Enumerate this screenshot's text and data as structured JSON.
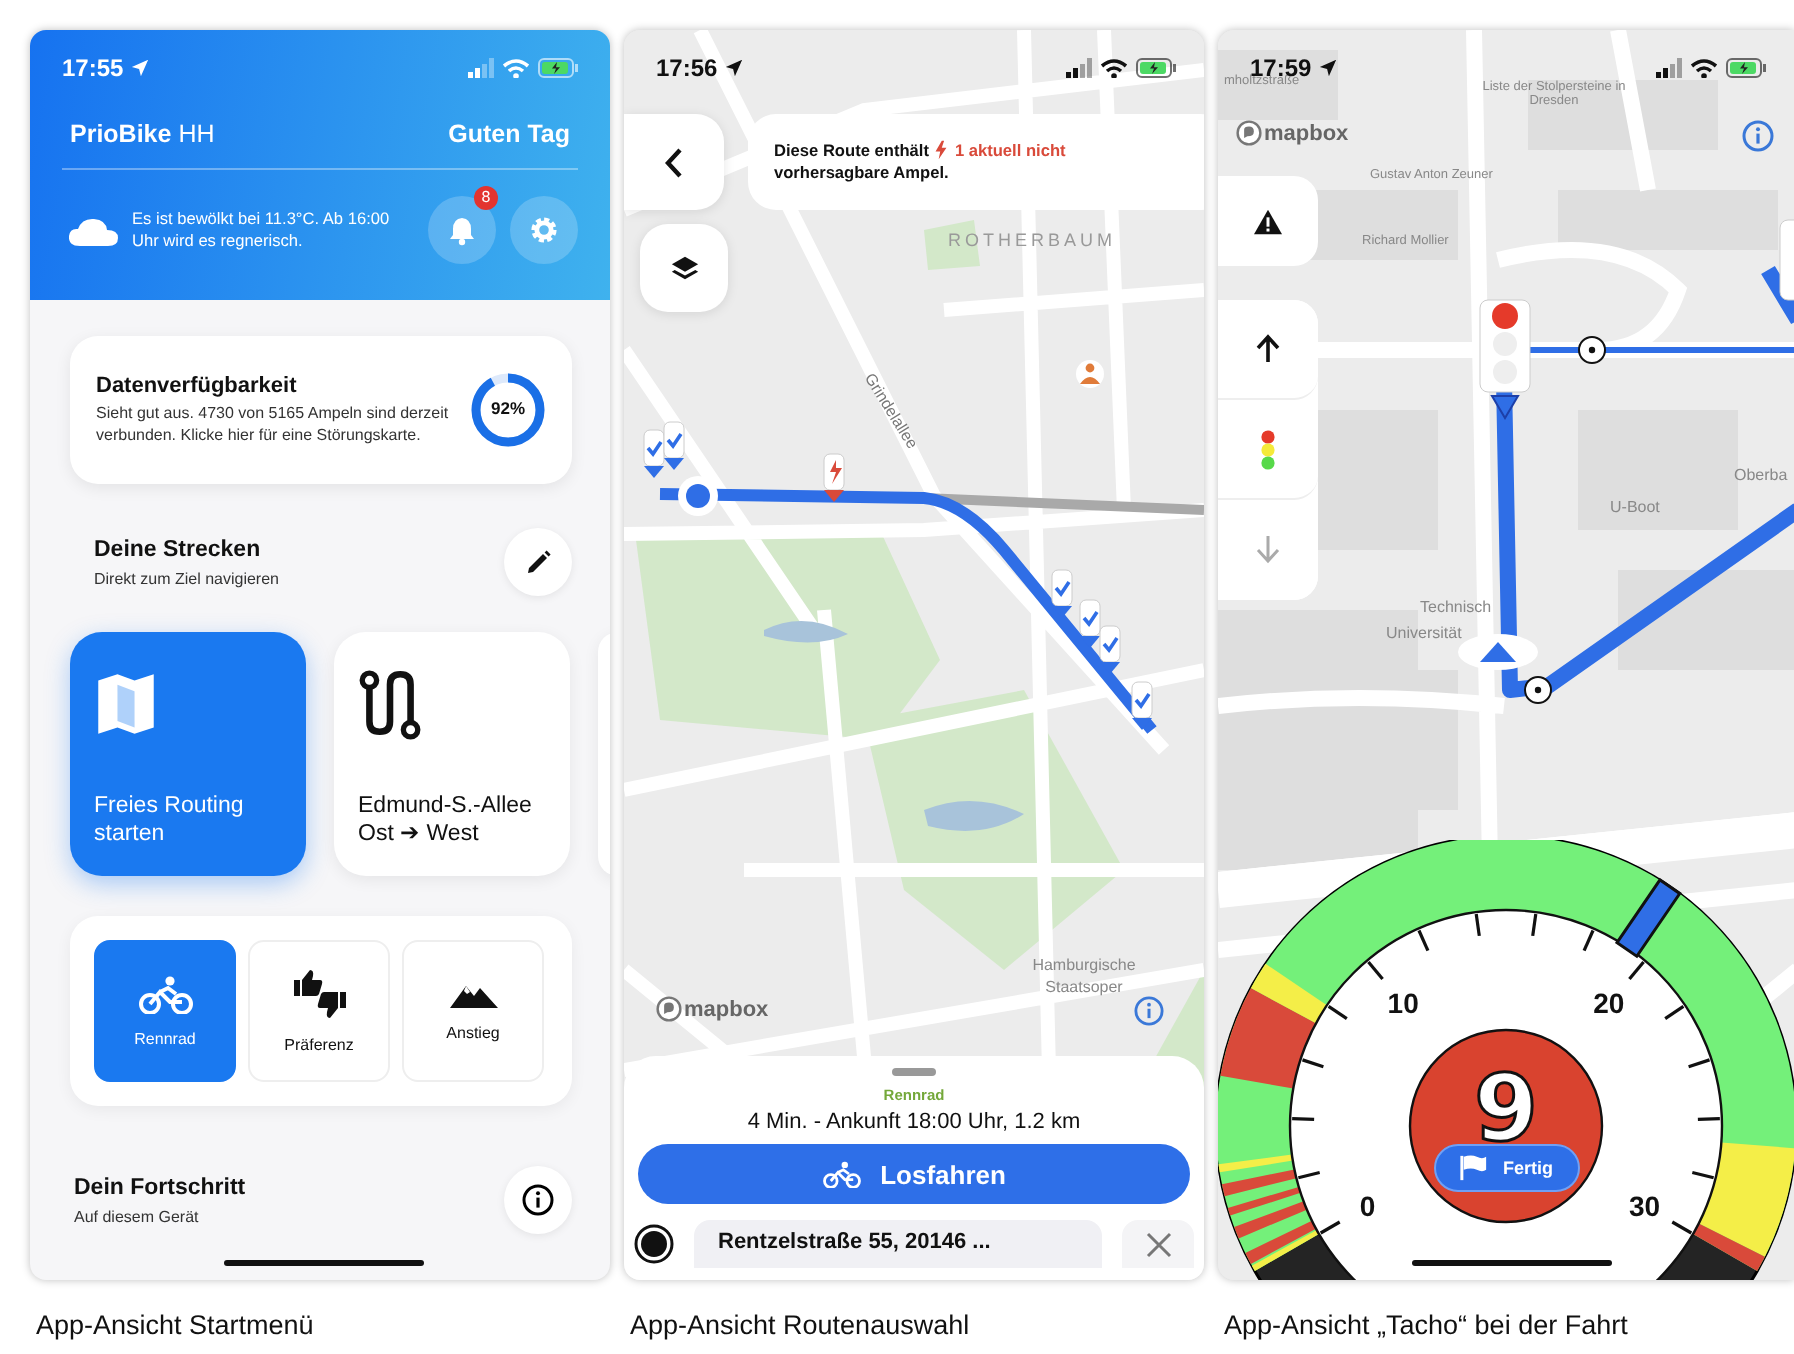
{
  "home_screen": {
    "status_bar": {
      "time": "17:55"
    },
    "app_title": "**PrioBike** HH",
    "greeting": "Guten Tag",
    "weather": "Es ist bewölkt bei 11.3°C. Ab 16:00 Uhr wird es regnerisch.",
    "notifications_badge": "8",
    "data_card": {
      "title": "Datenverfügbarkeit",
      "text": "Sieht gut aus. 4730 von 5165 Ampeln sind derzeit verbunden. Klicke hier für eine Störungskarte.",
      "percent": "92%",
      "level": 0.92
    },
    "routes_section": {
      "title": "Deine Strecken",
      "subtitle": "Direkt zum Ziel navigieren"
    },
    "route_cards": [
      {
        "kind": "free",
        "label": "Freies Routing starten"
      },
      {
        "kind": "saved",
        "label": "Edmund-S.-Allee Ost ➔ West"
      }
    ],
    "profile_buttons": [
      {
        "kind": "bike",
        "label": "Rennrad",
        "selected": true
      },
      {
        "kind": "thumbs",
        "label": "Präferenz",
        "selected": false
      },
      {
        "kind": "mountain",
        "label": "Anstieg",
        "selected": false
      }
    ],
    "progress_section": {
      "title": "Dein Fortschritt",
      "subtitle": "Auf diesem Gerät"
    },
    "caption": "App-Ansicht Startmenü"
  },
  "route_screen": {
    "status_bar": {
      "time": "17:56"
    },
    "banner": {
      "text_before": "Diese Route enthält",
      "warning": "1 aktuell nicht",
      "text_after": "vorhersagbare Ampel."
    },
    "map_labels": [
      "ROTHERBAUM",
      "Grindelallee",
      "Hamburgische Staatsoper"
    ],
    "map_logo": "mapbox",
    "sheet": {
      "profile": "Rennrad",
      "summary": "4 Min. - Ankunft 18:00 Uhr, 1.2 km",
      "start_button": "Losfahren",
      "destination": "Rentzelstraße 55, 20146 ..."
    },
    "caption": "App-Ansicht Routenauswahl"
  },
  "ride_screen": {
    "status_bar": {
      "time": "17:59"
    },
    "map_labels": [
      "mholtzstraße",
      "Liste der Stolpersteine in Dresden",
      "Gustav Anton Zeuner",
      "Richard Mollier",
      "U-Boot",
      "Technisch",
      "Universität",
      "Oberba"
    ],
    "map_logo": "mapbox",
    "gauge": {
      "ticks": [
        "0",
        "10",
        "20",
        "30"
      ],
      "speed": "9",
      "finish_button": "Fertig"
    },
    "caption": "App-Ansicht „Tacho“ bei der Fahrt"
  }
}
